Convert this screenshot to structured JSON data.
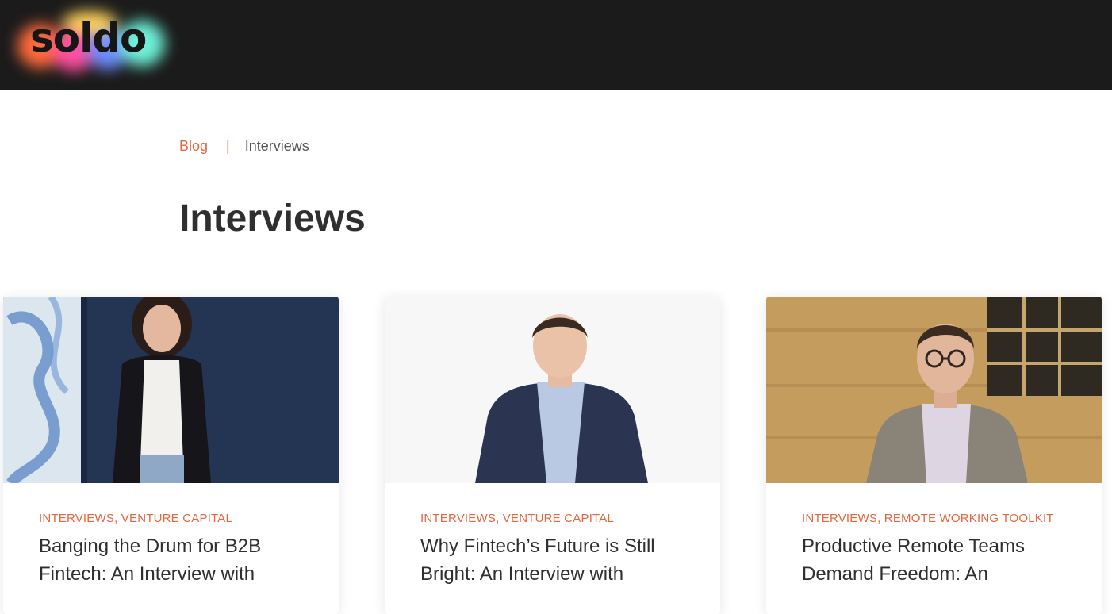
{
  "brand": {
    "logo_text": "soldo"
  },
  "breadcrumb": {
    "home": "Blog",
    "separator": "|",
    "current": "Interviews"
  },
  "page": {
    "title": "Interviews"
  },
  "cards": [
    {
      "categories": "Interviews, Venture Capital",
      "headline": "Banging the Drum for B2B Fintech: An Interview with"
    },
    {
      "categories": "Interviews, Venture Capital",
      "headline": "Why Fintech’s Future is Still Bright: An Interview with"
    },
    {
      "categories": "Interviews, Remote Working Toolkit",
      "headline": "Productive Remote Teams Demand Freedom: An"
    }
  ],
  "colors": {
    "accent": "#e5663f",
    "header_bg": "#1b1b1b",
    "title_text": "#2f2f2f"
  }
}
